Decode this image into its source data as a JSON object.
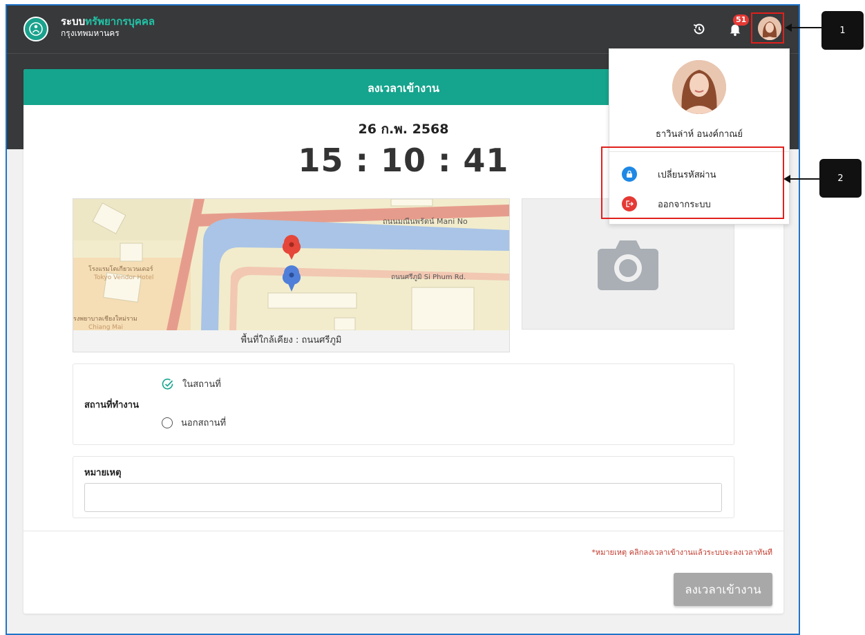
{
  "app": {
    "brand_prefix": "ระบบ",
    "brand_accent": "ทรัพยากรบุคคล",
    "brand_sub": "กรุงเทพมหานคร",
    "notification_count": "51"
  },
  "checkin": {
    "header": "ลงเวลาเข้างาน",
    "date": "26 ก.พ. 2568",
    "time": "15 : 10 : 41",
    "map_caption": "พื้นที่ใกล้เคียง : ถนนศรีภูมิ",
    "map_labels": {
      "road1": "ถนนมณีนพรัตน์ Mani No",
      "road2": "ถนนศรีภูมิ Si Phum Rd.",
      "hotel_th": "โรงแรมโตเกียวเวนเดอร์",
      "hotel_en": "Tokyo Vendor Hotel",
      "hospital_th": "รงพยาบาลเชียงใหม่ราม",
      "hospital_en": "Chiang Mai"
    },
    "work_place_label": "สถานที่ทำงาน",
    "options": {
      "onsite": "ในสถานที่",
      "offsite": "นอกสถานที่"
    },
    "note_label": "หมายเหตุ",
    "note_value": "",
    "hint": "*หมายเหตุ คลิกลงเวลาเข้างานแล้วระบบจะลงเวลาทันที",
    "submit_label": "ลงเวลาเข้างาน"
  },
  "profile_menu": {
    "name": "ธาวินล่าห์ อนงค์กาณย์",
    "change_password": "เปลี่ยนรหัสผ่าน",
    "logout": "ออกจากระบบ"
  },
  "callouts": {
    "one": "1",
    "two": "2"
  },
  "colors": {
    "topbar": "#37393b",
    "accent": "#15a48d",
    "highlight": "#e0201c",
    "hint": "#c0392b",
    "lock_icon_bg": "#1e88e5",
    "logout_icon_bg": "#e53935"
  }
}
